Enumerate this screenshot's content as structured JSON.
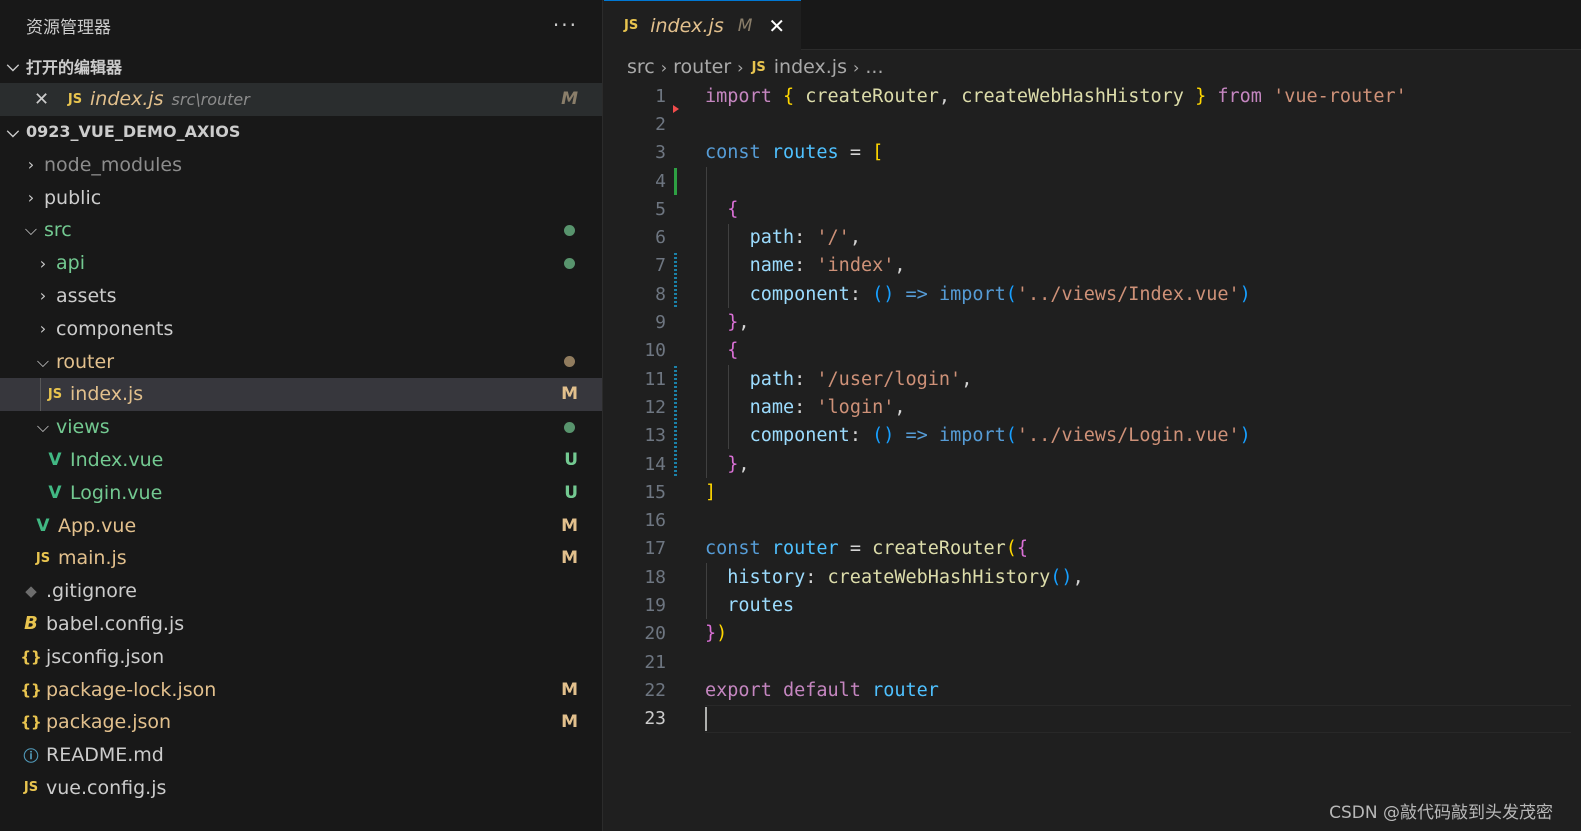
{
  "sidebar": {
    "title": "资源管理器",
    "more": "···",
    "open_editors_title": "打开的编辑器",
    "open_editor": {
      "name": "index.js",
      "path": "src\\router",
      "status": "M",
      "icon": "JS"
    },
    "project_title": "0923_VUE_DEMO_AXIOS",
    "tree": [
      {
        "name": "node_modules",
        "status": ""
      },
      {
        "name": "public",
        "status": ""
      },
      {
        "name": "src",
        "status": "dot"
      },
      {
        "name": "api",
        "status": "dot"
      },
      {
        "name": "assets",
        "status": ""
      },
      {
        "name": "components",
        "status": ""
      },
      {
        "name": "router",
        "status": "dot"
      },
      {
        "name": "index.js",
        "status": "M",
        "icon": "JS"
      },
      {
        "name": "views",
        "status": "dot"
      },
      {
        "name": "Index.vue",
        "status": "U"
      },
      {
        "name": "Login.vue",
        "status": "U"
      },
      {
        "name": "App.vue",
        "status": "M"
      },
      {
        "name": "main.js",
        "status": "M",
        "icon": "JS"
      },
      {
        "name": ".gitignore",
        "status": ""
      },
      {
        "name": "babel.config.js",
        "status": "",
        "icon": "B"
      },
      {
        "name": "jsconfig.json",
        "status": "",
        "icon": "{}"
      },
      {
        "name": "package-lock.json",
        "status": "M",
        "icon": "{}"
      },
      {
        "name": "package.json",
        "status": "M",
        "icon": "{}"
      },
      {
        "name": "README.md",
        "status": "",
        "icon": "ⓘ"
      },
      {
        "name": "vue.config.js",
        "status": "",
        "icon": "JS"
      }
    ]
  },
  "editor": {
    "tab": {
      "icon": "JS",
      "name": "index.js",
      "status": "M",
      "close": "✕"
    },
    "breadcrumb": {
      "p1": "src",
      "p2": "router",
      "icon": "JS",
      "p3": "index.js",
      "p4": "..."
    },
    "line_numbers": [
      "1",
      "2",
      "3",
      "4",
      "5",
      "6",
      "7",
      "8",
      "9",
      "10",
      "11",
      "12",
      "13",
      "14",
      "15",
      "16",
      "17",
      "18",
      "19",
      "20",
      "21",
      "22",
      "23"
    ],
    "code": {
      "l1": {
        "a": "import",
        "b": "{",
        "c": "createRouter",
        "d": ",",
        "e": "createWebHashHistory",
        "f": "}",
        "g": "from",
        "h": "'vue-router'"
      },
      "l3": {
        "a": "const",
        "b": "routes",
        "c": "=",
        "d": "["
      },
      "l5": {
        "a": "{"
      },
      "l6": {
        "a": "path",
        "b": ":",
        "c": "'/'",
        "d": ","
      },
      "l7": {
        "a": "name",
        "b": ":",
        "c": "'index'",
        "d": ","
      },
      "l8": {
        "a": "component",
        "b": ":",
        "c": "()",
        "d": "=>",
        "e": "import",
        "f": "(",
        "g": "'../views/Index.vue'",
        "h": ")"
      },
      "l9": {
        "a": "}",
        "b": ","
      },
      "l10": {
        "a": "{"
      },
      "l11": {
        "a": "path",
        "b": ":",
        "c": "'/user/login'",
        "d": ","
      },
      "l12": {
        "a": "name",
        "b": ":",
        "c": "'login'",
        "d": ","
      },
      "l13": {
        "a": "component",
        "b": ":",
        "c": "()",
        "d": "=>",
        "e": "import",
        "f": "(",
        "g": "'../views/Login.vue'",
        "h": ")"
      },
      "l14": {
        "a": "}",
        "b": ","
      },
      "l15": {
        "a": "]"
      },
      "l17": {
        "a": "const",
        "b": "router",
        "c": "=",
        "d": "createRouter",
        "e": "(",
        "f": "{"
      },
      "l18": {
        "a": "history",
        "b": ":",
        "c": "createWebHashHistory",
        "d": "()",
        "e": ","
      },
      "l19": {
        "a": "routes"
      },
      "l20": {
        "a": "}",
        "b": ")"
      },
      "l22": {
        "a": "export",
        "b": "default",
        "c": "router"
      }
    }
  },
  "watermark": "CSDN @敲代码敲到头发茂密",
  "colors": {
    "modified": "#e2c08d",
    "untracked": "#73c991",
    "accent": "#0078d4"
  }
}
